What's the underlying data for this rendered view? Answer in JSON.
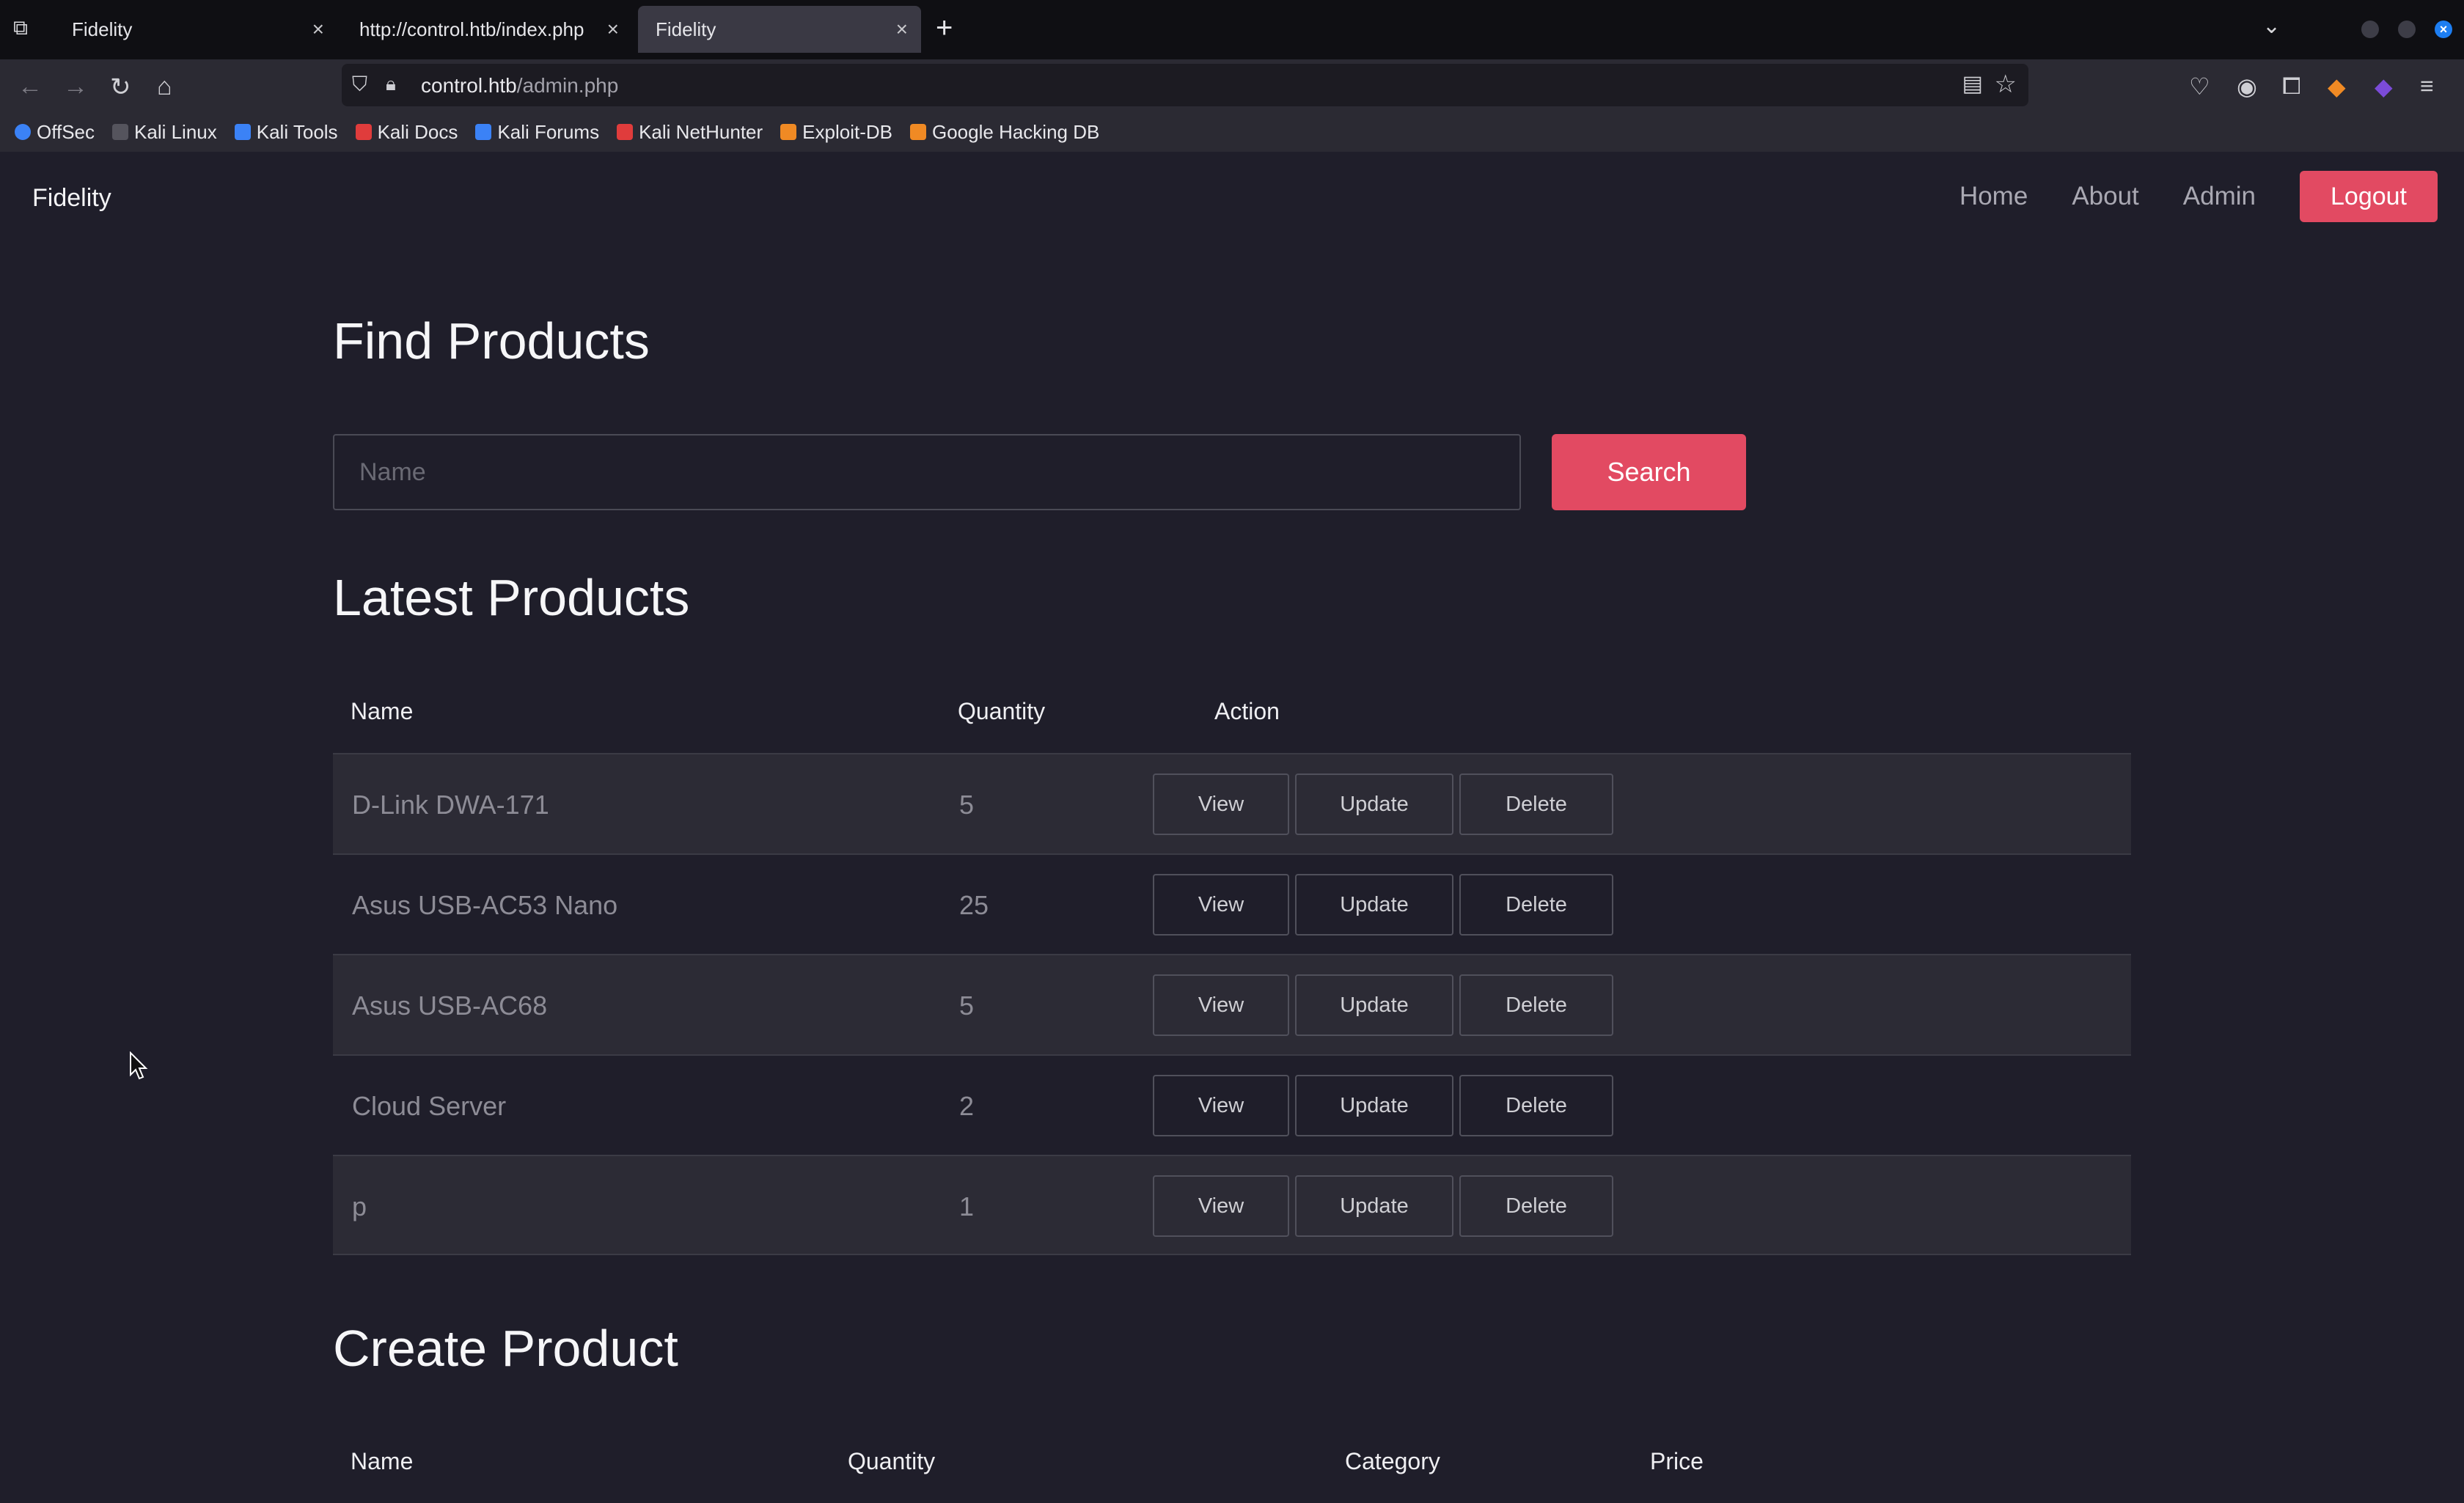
{
  "browser": {
    "tabs": [
      {
        "title": "Fidelity"
      },
      {
        "title": "http://control.htb/index.php"
      },
      {
        "title": "Fidelity"
      }
    ],
    "url_host": "control.htb",
    "url_path": "/admin.php",
    "bookmarks": [
      {
        "label": "OffSec",
        "color": "#3b82f6"
      },
      {
        "label": "Kali Linux",
        "color": "#2b2a33"
      },
      {
        "label": "Kali Tools",
        "color": "#3b82f6"
      },
      {
        "label": "Kali Docs",
        "color": "#e03c3c"
      },
      {
        "label": "Kali Forums",
        "color": "#3b82f6"
      },
      {
        "label": "Kali NetHunter",
        "color": "#e03c3c"
      },
      {
        "label": "Exploit-DB",
        "color": "#f08a24"
      },
      {
        "label": "Google Hacking DB",
        "color": "#f08a24"
      }
    ]
  },
  "site": {
    "brand": "Fidelity",
    "nav": [
      "Home",
      "About",
      "Admin"
    ],
    "logout_label": "Logout",
    "accent": "#e24a62"
  },
  "find": {
    "heading": "Find Products",
    "placeholder": "Name",
    "search_label": "Search"
  },
  "latest": {
    "heading": "Latest Products",
    "columns": [
      "Name",
      "Quantity",
      "Action"
    ],
    "rows": [
      {
        "name": "D-Link DWA-171",
        "qty": "5"
      },
      {
        "name": "Asus USB-AC53 Nano",
        "qty": "25"
      },
      {
        "name": "Asus USB-AC68",
        "qty": "5"
      },
      {
        "name": "Cloud Server",
        "qty": "2"
      },
      {
        "name": "p",
        "qty": "1"
      }
    ],
    "actions": {
      "view": "View",
      "update": "Update",
      "delete": "Delete"
    }
  },
  "create": {
    "heading": "Create Product",
    "columns": [
      "Name",
      "Quantity",
      "Category",
      "Price"
    ]
  }
}
